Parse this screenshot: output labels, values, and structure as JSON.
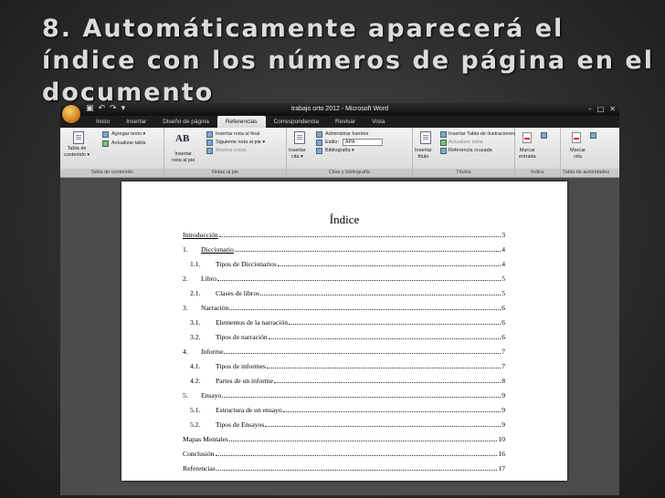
{
  "slide": {
    "title": "8. Automáticamente aparecerá el índice con los números de página en el documento"
  },
  "word": {
    "window_title": "trabajo orto 2012 - Microsoft Word",
    "tabs": [
      "Inicio",
      "Insertar",
      "Diseño de página",
      "Referencias",
      "Correspondencia",
      "Revisar",
      "Vista"
    ],
    "active_tab": "Referencias",
    "ribbon": {
      "toc_group": {
        "label": "Tabla de contenido",
        "big_button": "Tabla de\ncontenido ▾",
        "add_text": "Agregar texto ▾",
        "update_table": "Actualizar tabla"
      },
      "footnotes_group": {
        "label": "Notas al pie",
        "big_button": "Insertar\nnota al pie",
        "insert_endnote": "Insertar nota al final",
        "next_footnote": "Siguiente nota al pie ▾",
        "show_notes": "Mostrar notas",
        "ab_icon": "AB"
      },
      "citations_group": {
        "label": "Citas y bibliografía",
        "big_button": "Insertar\ncita ▾",
        "manage_sources": "Administrar fuentes",
        "style_label": "Estilo:",
        "style_value": "APA",
        "bibliography": "Bibliografía ▾"
      },
      "captions_group": {
        "label": "Títulos",
        "big_button": "Insertar\ntítulo",
        "insert_table_figures": "Insertar Tabla de ilustraciones",
        "update_table": "Actualizar tabla",
        "cross_reference": "Referencia cruzada"
      },
      "index_group": {
        "label": "Índice",
        "big_button": "Marcar\nentrada"
      },
      "authorities_group": {
        "label": "Tabla de autoridades",
        "big_button": "Marcar\ncita"
      }
    },
    "document": {
      "index_title": "Índice",
      "entries": [
        {
          "level": 0,
          "num": "",
          "text": "Introducción",
          "page": "3",
          "underline": true
        },
        {
          "level": 1,
          "num": "1.",
          "text": "Diccionario",
          "page": "4",
          "underline": true
        },
        {
          "level": 2,
          "num": "1.1.",
          "text": "Tipos de Diccionarios",
          "page": "4",
          "underline": false
        },
        {
          "level": 1,
          "num": "2.",
          "text": "Libro",
          "page": "5",
          "underline": false
        },
        {
          "level": 2,
          "num": "2.1.",
          "text": "Clases de libros",
          "page": "5",
          "underline": false
        },
        {
          "level": 1,
          "num": "3.",
          "text": "Narración",
          "page": "6",
          "underline": false
        },
        {
          "level": 2,
          "num": "3.1.",
          "text": "Elementos de la narración",
          "page": "6",
          "underline": false
        },
        {
          "level": 2,
          "num": "3.2.",
          "text": "Tipos de narración",
          "page": "6",
          "underline": false
        },
        {
          "level": 1,
          "num": "4.",
          "text": "Informe",
          "page": "7",
          "underline": false
        },
        {
          "level": 2,
          "num": "4.1.",
          "text": "Tipos de informes",
          "page": "7",
          "underline": false
        },
        {
          "level": 2,
          "num": "4.2.",
          "text": "Partes de un informe",
          "page": "8",
          "underline": false
        },
        {
          "level": 1,
          "num": "5.",
          "text": "Ensayo",
          "page": "9",
          "underline": false
        },
        {
          "level": 2,
          "num": "5.1.",
          "text": "Estructura de un ensayo",
          "page": "9",
          "underline": false
        },
        {
          "level": 2,
          "num": "5.2.",
          "text": "Tipos de Ensayos",
          "page": "9",
          "underline": false
        },
        {
          "level": 0,
          "num": "",
          "text": "Mapas Mentales",
          "page": "10",
          "underline": false
        },
        {
          "level": 0,
          "num": "",
          "text": "Conclusión",
          "page": "16",
          "underline": false
        },
        {
          "level": 0,
          "num": "",
          "text": "Referencias",
          "page": "17",
          "underline": false
        }
      ]
    }
  }
}
